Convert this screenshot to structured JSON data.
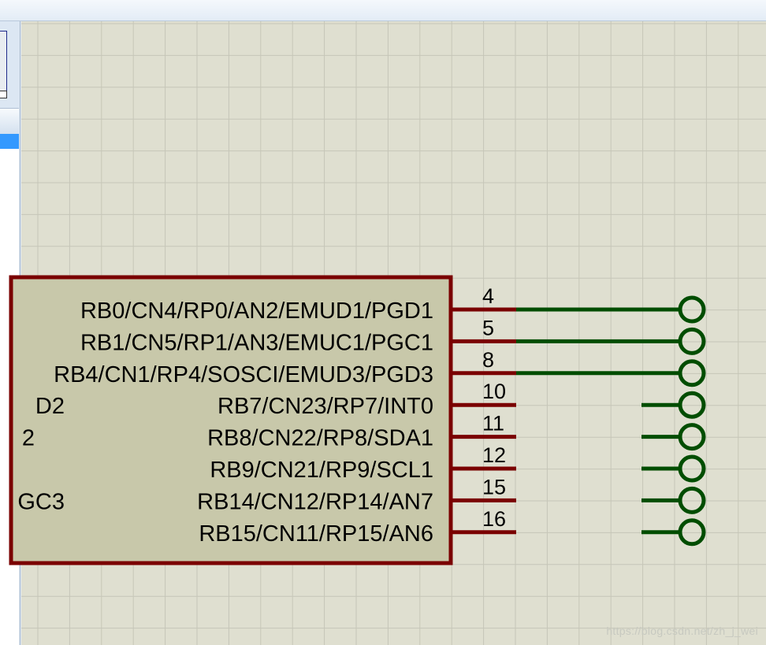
{
  "schematic": {
    "component": {
      "left_pins": [
        {
          "label": "RB0/CN4/RP0/AN2/EMUD1/PGD1",
          "number": "4",
          "connected": true
        },
        {
          "label": "RB1/CN5/RP1/AN3/EMUC1/PGC1",
          "number": "5",
          "connected": true
        },
        {
          "label": "RB4/CN1/RP4/SOSCI/EMUD3/PGD3",
          "number": "8",
          "connected": true
        },
        {
          "label": "RB7/CN23/RP7/INT0",
          "number": "10",
          "connected": false
        },
        {
          "label": "RB8/CN22/RP8/SDA1",
          "number": "11",
          "connected": false
        },
        {
          "label": "RB9/CN21/RP9/SCL1",
          "number": "12",
          "connected": false
        },
        {
          "label": "RB14/CN12/RP14/AN7",
          "number": "15",
          "connected": false
        },
        {
          "label": "RB15/CN11/RP15/AN6",
          "number": "16",
          "connected": false
        }
      ],
      "clipped_left_labels": [
        "D2",
        "2",
        "",
        "GC3"
      ]
    },
    "watermark": "https://blog.csdn.net/zh_j_wei"
  },
  "colors": {
    "canvas_bg": "#dfdfd0",
    "grid": "#c6c6b8",
    "component_fill": "#c8c8aa",
    "component_border": "#7a0000",
    "wire": "#004d00",
    "terminal": "#004d00"
  }
}
